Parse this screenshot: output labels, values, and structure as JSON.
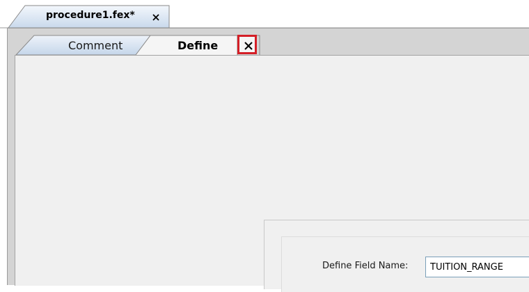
{
  "file_tab": {
    "label": "procedure1.fex*",
    "close_icon": "close-icon"
  },
  "sub_tabs": {
    "items": [
      {
        "label": "Comment",
        "active": false
      },
      {
        "label": "Define",
        "active": true
      }
    ],
    "close_icon": "close-icon"
  },
  "define_panel": {
    "field_name_label": "Define Field Name:",
    "field_name_value": "TUITION_RANGE"
  },
  "colors": {
    "tab_gradient_light": "#eef3fa",
    "tab_gradient_dark": "#c5d6ea",
    "highlight_border": "#d41f27",
    "content_bg": "#f0f0f0"
  }
}
